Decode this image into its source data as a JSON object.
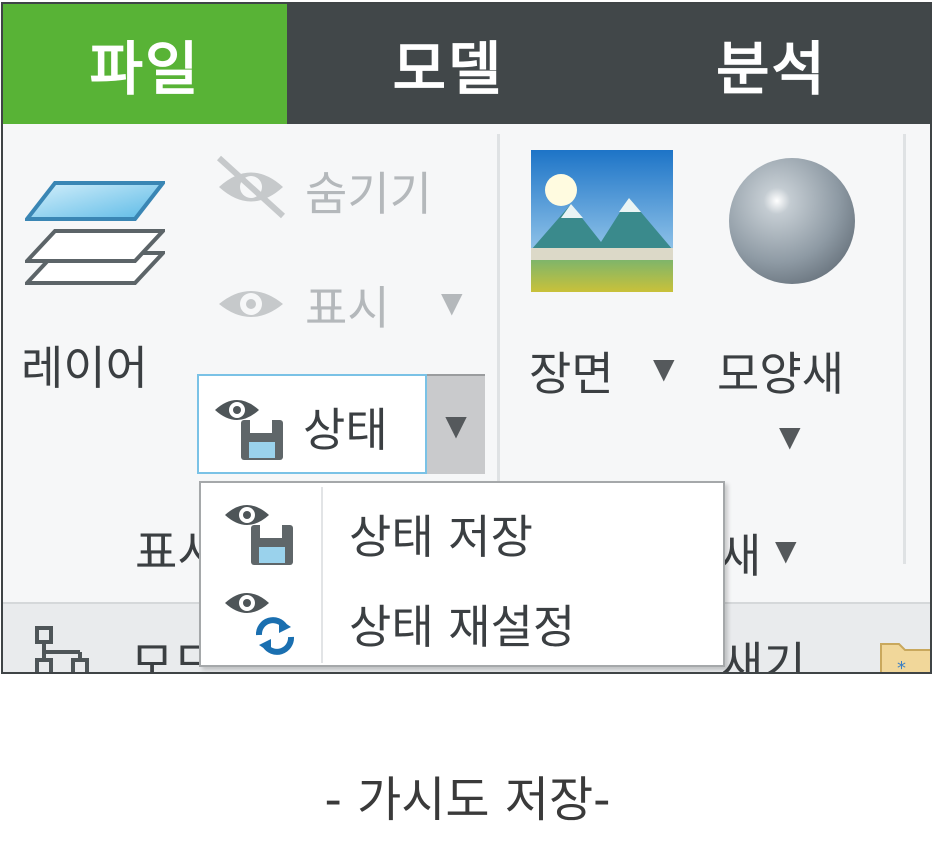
{
  "tabs": [
    {
      "label": "파일",
      "active": true
    },
    {
      "label": "모델",
      "active": false
    },
    {
      "label": "분석",
      "active": false
    }
  ],
  "ribbon": {
    "layer_label": "레이어",
    "hide_label": "숨기기",
    "show_label": "표시",
    "state_label": "상태",
    "group_label_partial": "표시",
    "scene_label": "장면",
    "appearance_label": "모양새",
    "appearance_group_partial": "새",
    "bottom_left_partial": "모드",
    "bottom_mid_partial": "새기"
  },
  "state_menu": {
    "items": [
      {
        "label": "상태 저장",
        "icon": "eye-save-icon"
      },
      {
        "label": "상태 재설정",
        "icon": "eye-refresh-icon"
      }
    ]
  },
  "caption": "- 가시도 저장-",
  "colors": {
    "tab_bar": "#414749",
    "tab_active": "#58b336",
    "focus_border": "#7ac2e6"
  }
}
